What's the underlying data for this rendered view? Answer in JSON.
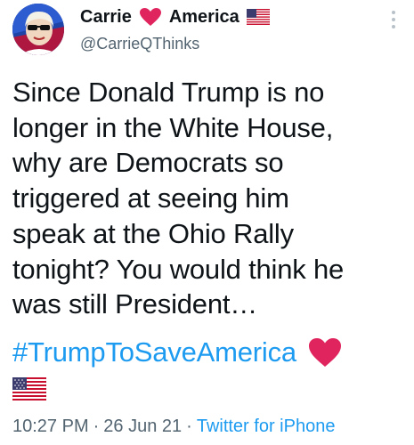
{
  "tweet": {
    "display_name_first": "Carrie",
    "display_name_second": "America",
    "handle": "@CarrieQThinks",
    "text_lines": [
      "Since Donald Trump is no",
      "longer in the White House,",
      "why are Democrats so",
      "triggered at seeing him",
      "speak at the Ohio Rally",
      "tonight? You would think he",
      "was still President…"
    ],
    "hashtag": "#TrumpToSaveAmerica",
    "time": "10:27 PM",
    "date": "26 Jun 21",
    "source": "Twitter for iPhone",
    "separator": "·"
  },
  "icons": {
    "name_heart": "red-heart-icon",
    "name_flag": "us-flag-icon",
    "text_heart": "red-heart-icon",
    "text_flag": "us-flag-icon",
    "more": "more-options-icon"
  },
  "colors": {
    "link": "#1d9bf0",
    "secondary": "#536471",
    "heart": "#e0245e"
  }
}
